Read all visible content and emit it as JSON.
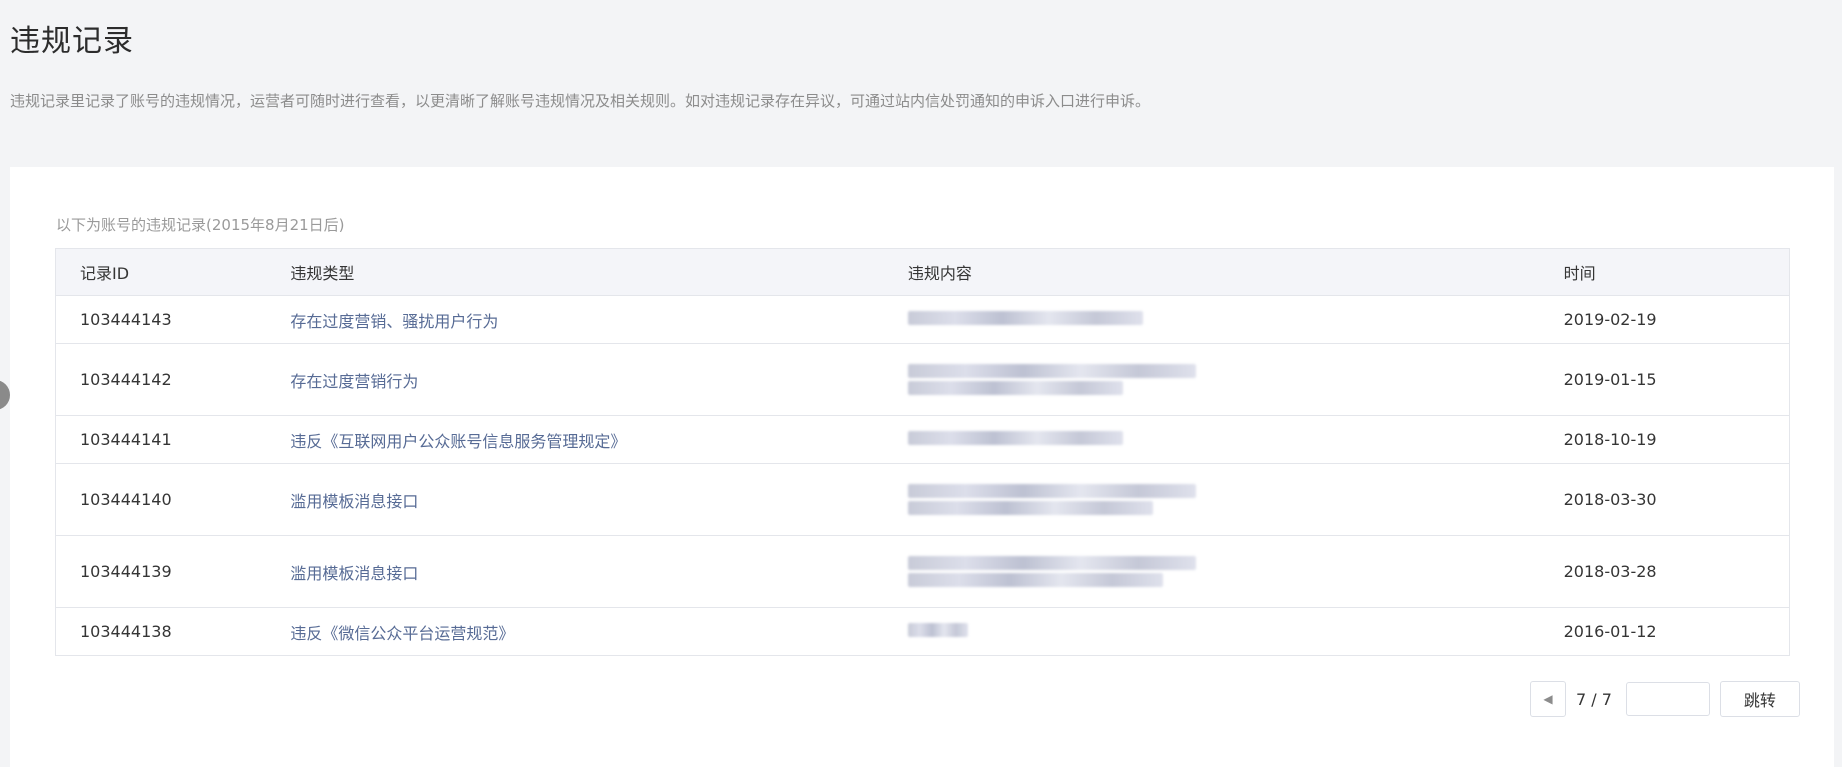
{
  "page": {
    "title": "违规记录",
    "description": "违规记录里记录了账号的违规情况，运营者可随时进行查看，以更清晰了解账号违规情况及相关规则。如对违规记录存在异议，可通过站内信处罚通知的申诉入口进行申诉。"
  },
  "card": {
    "caption": "以下为账号的违规记录(2015年8月21日后)"
  },
  "table": {
    "headers": {
      "id": "记录ID",
      "type": "违规类型",
      "content": "违规内容",
      "time": "时间"
    },
    "rows": [
      {
        "id": "103444143",
        "type": "存在过度营销、骚扰用户行为",
        "time": "2019-02-19"
      },
      {
        "id": "103444142",
        "type": "存在过度营销行为",
        "time": "2019-01-15"
      },
      {
        "id": "103444141",
        "type": "违反《互联网用户公众账号信息服务管理规定》",
        "time": "2018-10-19"
      },
      {
        "id": "103444140",
        "type": "滥用模板消息接口",
        "time": "2018-03-30"
      },
      {
        "id": "103444139",
        "type": "滥用模板消息接口",
        "time": "2018-03-28"
      },
      {
        "id": "103444138",
        "type": "违反《微信公众平台运营规范》",
        "time": "2016-01-12"
      }
    ]
  },
  "pagination": {
    "prev_icon": "caret-left-icon",
    "page_info": "7 / 7",
    "input_value": "",
    "jump_label": "跳转"
  }
}
